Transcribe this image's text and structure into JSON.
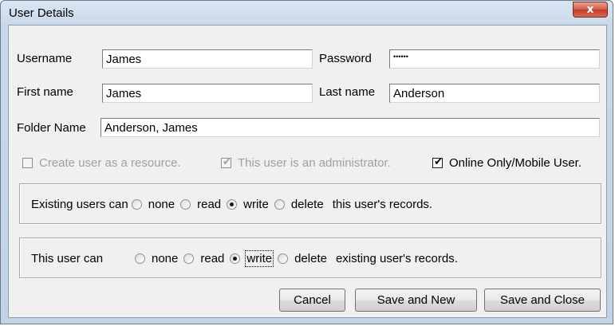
{
  "window": {
    "title": "User Details",
    "close_label": "x"
  },
  "fields": {
    "username": {
      "label": "Username",
      "value": "James"
    },
    "password": {
      "label": "Password",
      "value": "••••••"
    },
    "first_name": {
      "label": "First name",
      "value": "James"
    },
    "last_name": {
      "label": "Last name",
      "value": "Anderson"
    },
    "folder_name": {
      "label": "Folder Name",
      "value": "Anderson, James"
    }
  },
  "checkboxes": {
    "create_resource": {
      "label": "Create user as a resource.",
      "checked": false,
      "enabled": false
    },
    "administrator": {
      "label": "This user is an administrator.",
      "checked": true,
      "enabled": false
    },
    "online_only": {
      "label": "Online Only/Mobile User.",
      "checked": true,
      "enabled": true
    }
  },
  "existing_users_group": {
    "prefix": "Existing users can",
    "options": [
      "none",
      "read",
      "write",
      "delete"
    ],
    "selected": "write",
    "suffix": "this user's records."
  },
  "this_user_group": {
    "prefix": "This user can",
    "options": [
      "none",
      "read",
      "write",
      "delete"
    ],
    "selected": "write",
    "suffix": "existing user's records."
  },
  "buttons": {
    "cancel": "Cancel",
    "save_new": "Save and New",
    "save_close": "Save and Close"
  },
  "glyphs": {
    "check": "✔"
  }
}
